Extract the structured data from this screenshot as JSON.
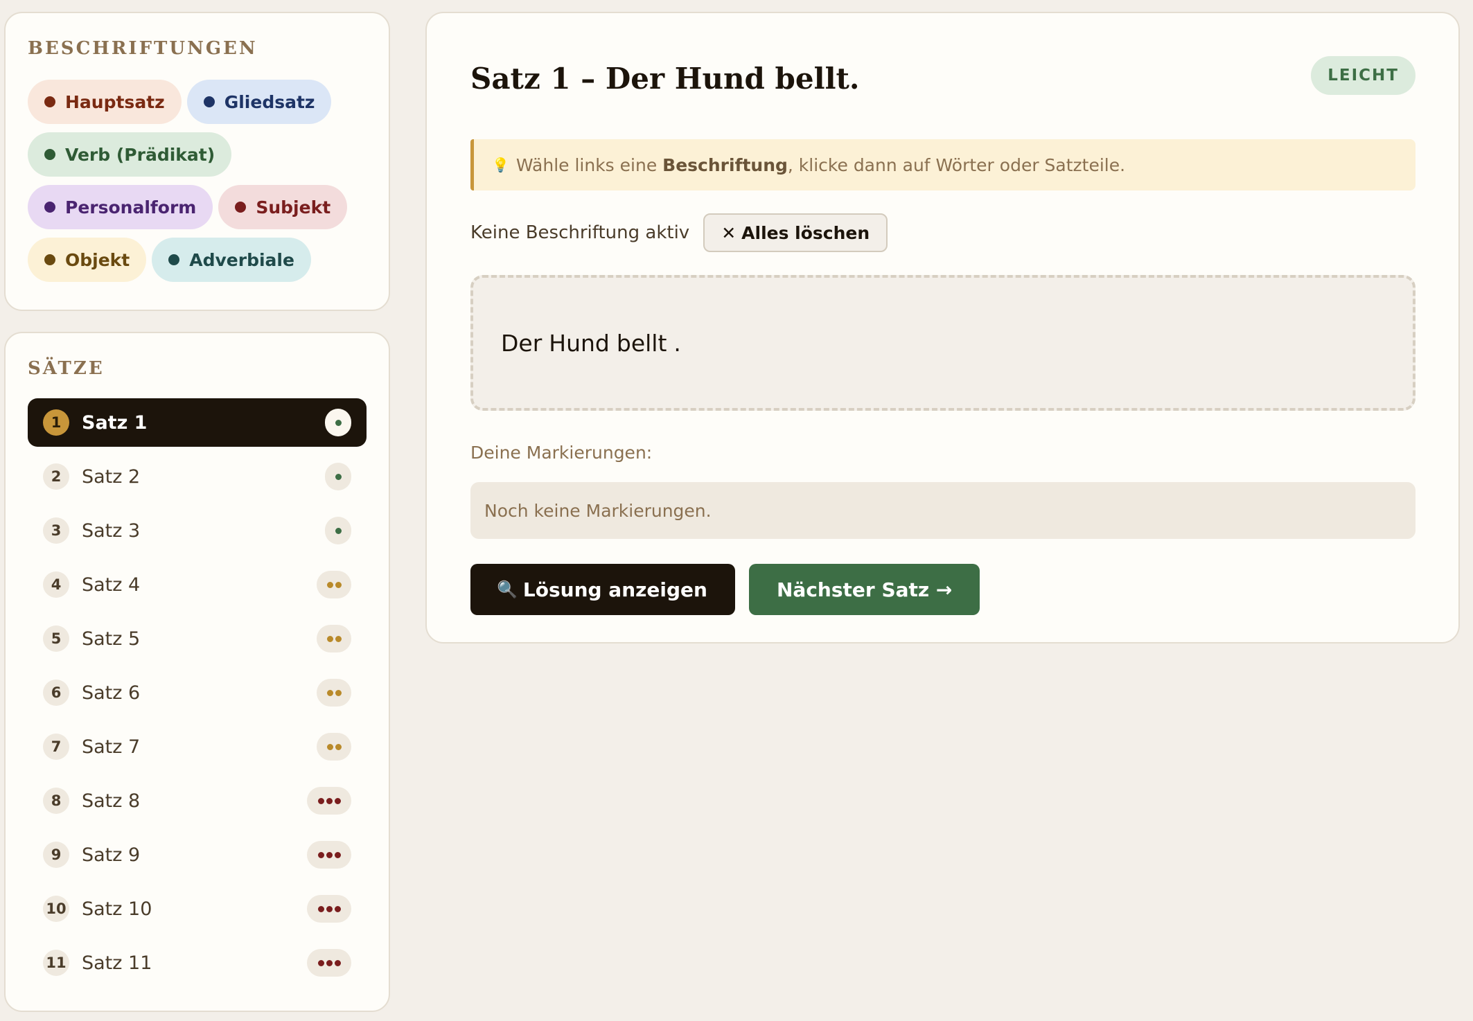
{
  "labels": {
    "title": "BESCHRIFTUNGEN",
    "chips": [
      {
        "label": "Hauptsatz",
        "bg": "#f9e7dc",
        "fg": "#7a2a12",
        "dot": "#7a2a12"
      },
      {
        "label": "Gliedsatz",
        "bg": "#dbe6f6",
        "fg": "#1e3466",
        "dot": "#1e3466"
      },
      {
        "label": "Verb (Prädikat)",
        "bg": "#dcebdd",
        "fg": "#2f5b35",
        "dot": "#2f5b35"
      },
      {
        "label": "Personalform",
        "bg": "#e8d9f3",
        "fg": "#4a2470",
        "dot": "#4a2470"
      },
      {
        "label": "Subjekt",
        "bg": "#f3dcdc",
        "fg": "#7a1e1e",
        "dot": "#7a1e1e"
      },
      {
        "label": "Objekt",
        "bg": "#fcf1d6",
        "fg": "#6a4a10",
        "dot": "#6a4a10"
      },
      {
        "label": "Adverbiale",
        "bg": "#d6ecec",
        "fg": "#1f4a4a",
        "dot": "#1f4a4a"
      }
    ]
  },
  "saetze": {
    "title": "SÄTZE",
    "items": [
      {
        "num": "1",
        "label": "Satz 1",
        "difficulty": 1,
        "active": true
      },
      {
        "num": "2",
        "label": "Satz 2",
        "difficulty": 1
      },
      {
        "num": "3",
        "label": "Satz 3",
        "difficulty": 1
      },
      {
        "num": "4",
        "label": "Satz 4",
        "difficulty": 2
      },
      {
        "num": "5",
        "label": "Satz 5",
        "difficulty": 2
      },
      {
        "num": "6",
        "label": "Satz 6",
        "difficulty": 2
      },
      {
        "num": "7",
        "label": "Satz 7",
        "difficulty": 2
      },
      {
        "num": "8",
        "label": "Satz 8",
        "difficulty": 3
      },
      {
        "num": "9",
        "label": "Satz 9",
        "difficulty": 3
      },
      {
        "num": "10",
        "label": "Satz 10",
        "difficulty": 3
      },
      {
        "num": "11",
        "label": "Satz 11",
        "difficulty": 3
      }
    ],
    "difficulty_colors": {
      "1": "#3d6e45",
      "2": "#b98a2a",
      "3": "#7a1e1e"
    }
  },
  "main": {
    "title": "Satz 1 – Der Hund bellt.",
    "level": "LEICHT",
    "hint": {
      "icon": "💡",
      "before": "Wähle links eine ",
      "bold": "Beschriftung",
      "after": ", klicke dann auf Wörter oder Satzteile."
    },
    "status_text": "Keine Beschriftung aktiv",
    "clear_icon": "✕",
    "clear_label": "Alles löschen",
    "words": [
      "Der",
      "Hund",
      "bellt",
      "."
    ],
    "marks_label": "Deine Markierungen:",
    "marks_empty": "Noch keine Markierungen.",
    "solution_icon": "🔍",
    "solution_label": "Lösung anzeigen",
    "next_label": "Nächster Satz →"
  }
}
